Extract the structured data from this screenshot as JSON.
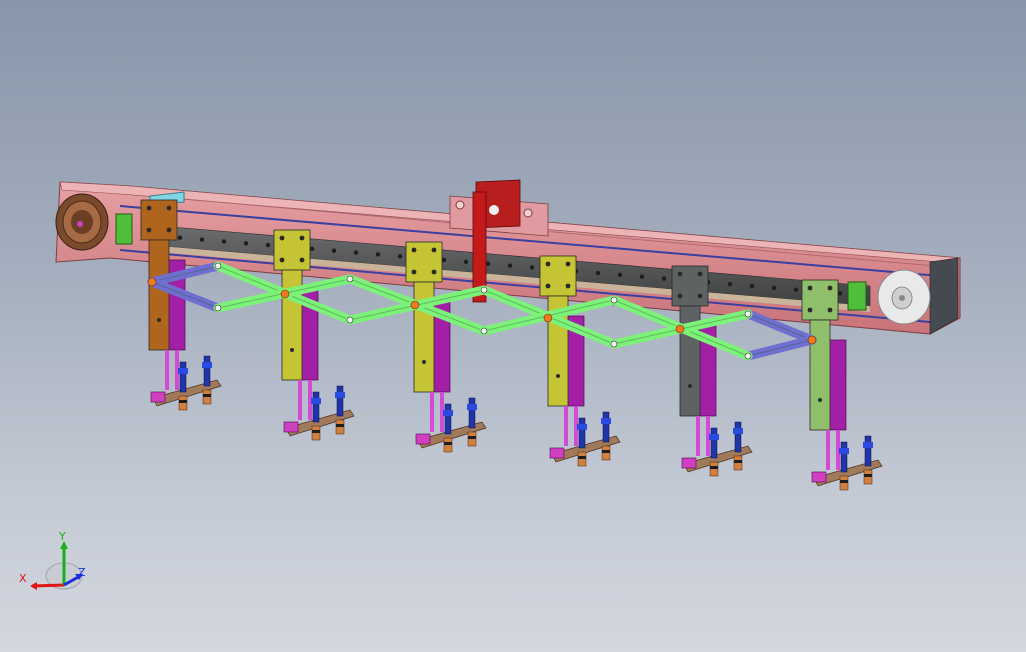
{
  "viewport": {
    "background_top": "#8896aa",
    "background_bottom": "#d3d7df"
  },
  "model": {
    "gripper_count": 6,
    "carriage_colors": [
      "#b0651f",
      "#c4c434",
      "#c4c434",
      "#c4c434",
      "#5f6263",
      "#8fbf6a"
    ],
    "scissor_link_color": "#7df27a",
    "end_link_color": "#6f6fd0",
    "beam_color": "#d9878c",
    "actuator_color": "#c41a1a",
    "cylinder_color": "#a21fa6",
    "suction_cup_color": "#1f35a8"
  },
  "triad": {
    "x_label": "X",
    "y_label": "Y",
    "z_label": "Z",
    "x_color": "#e01515",
    "y_color": "#18b018",
    "z_color": "#1a2ee0"
  }
}
